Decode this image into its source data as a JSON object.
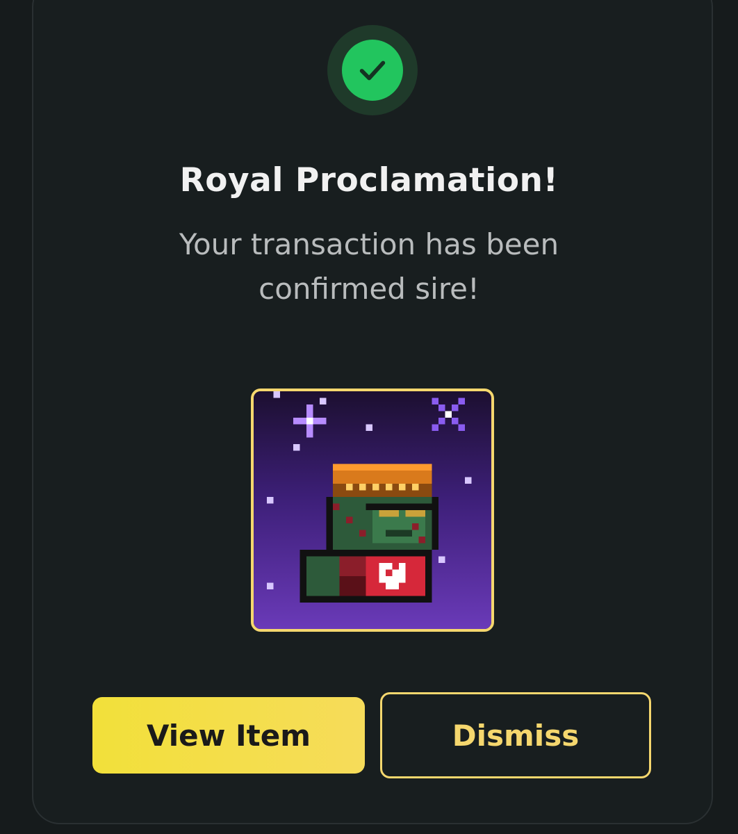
{
  "modal": {
    "title": "Royal Proclamation!",
    "message_line1": "Your transaction has been",
    "message_line2": "confirmed sire!",
    "status_icon": "check-icon",
    "nft_image": "pixel-art-character-nft"
  },
  "actions": {
    "view_label": "View Item",
    "dismiss_label": "Dismiss"
  },
  "colors": {
    "background": "#161b1c",
    "card": "#181e1f",
    "success": "#22c55e",
    "accent": "#f5d76e",
    "text_primary": "#f1f1f1",
    "text_secondary": "#b9bcbd"
  }
}
